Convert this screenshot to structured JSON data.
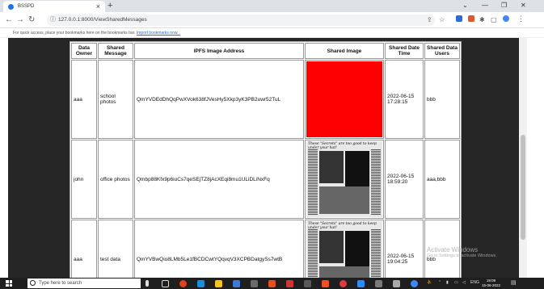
{
  "browser": {
    "tab_title": "BSSPD",
    "tab_close": "×",
    "new_tab": "+",
    "url": "127.0.0.1:8000/ViewSharedMessages",
    "bookmarks_text": "For quick access, place your bookmarks here on the bookmarks bar.",
    "bookmarks_link": "Import bookmarks now..."
  },
  "table": {
    "headers": {
      "data_owner": "Data Owner",
      "shared_message": "Shared Message",
      "ipfs_address": "IPFS Image Address",
      "shared_image": "Shared Image",
      "shared_date_time": "Shared Date Time",
      "shared_data_users": "Shared Data Users"
    },
    "rows": [
      {
        "owner": "aaa",
        "message": "school photos",
        "ipfs": "QmYVDEdDhQqPwXVok638fJVesHy5Xkp3yK3PB2uwr52TuL",
        "image": "red",
        "datetime": "2022-06-15 17:28:15",
        "users": "bbb"
      },
      {
        "owner": "john",
        "message": "office photos",
        "ipfs": "Qmbp88Kfx9p6iuCs7qeSEjTZ8jAcXEqi8mu1ULiDLiNxFq",
        "image": "newspaper",
        "newspaper_headline": "These \"Secrets\" are too good to keep under your hat!",
        "datetime": "2022-06-15 18:59:20",
        "users": "aaa,bbb"
      },
      {
        "owner": "aaa",
        "message": "test data",
        "ipfs": "QmYVBwQio8LMb5Le1fBCDCwtYQqvqV3XCPBDatgySs7wtB",
        "image": "newspaper",
        "newspaper_headline": "These \"Secrets\" are too good to keep under your hat!",
        "datetime": "2022-06-15 19:04:25",
        "users": "bbb"
      }
    ]
  },
  "watermark": {
    "line1": "Activate Windows",
    "line2": "Go to Settings to activate Windows."
  },
  "taskbar": {
    "search_placeholder": "Type here to search",
    "time": "19:09",
    "date": "15-06-2022",
    "tray_lang": "ENG"
  },
  "colors": {
    "page_background": "#262626",
    "red_image": "#ff0000",
    "taskbar": "#1f1f1f"
  }
}
